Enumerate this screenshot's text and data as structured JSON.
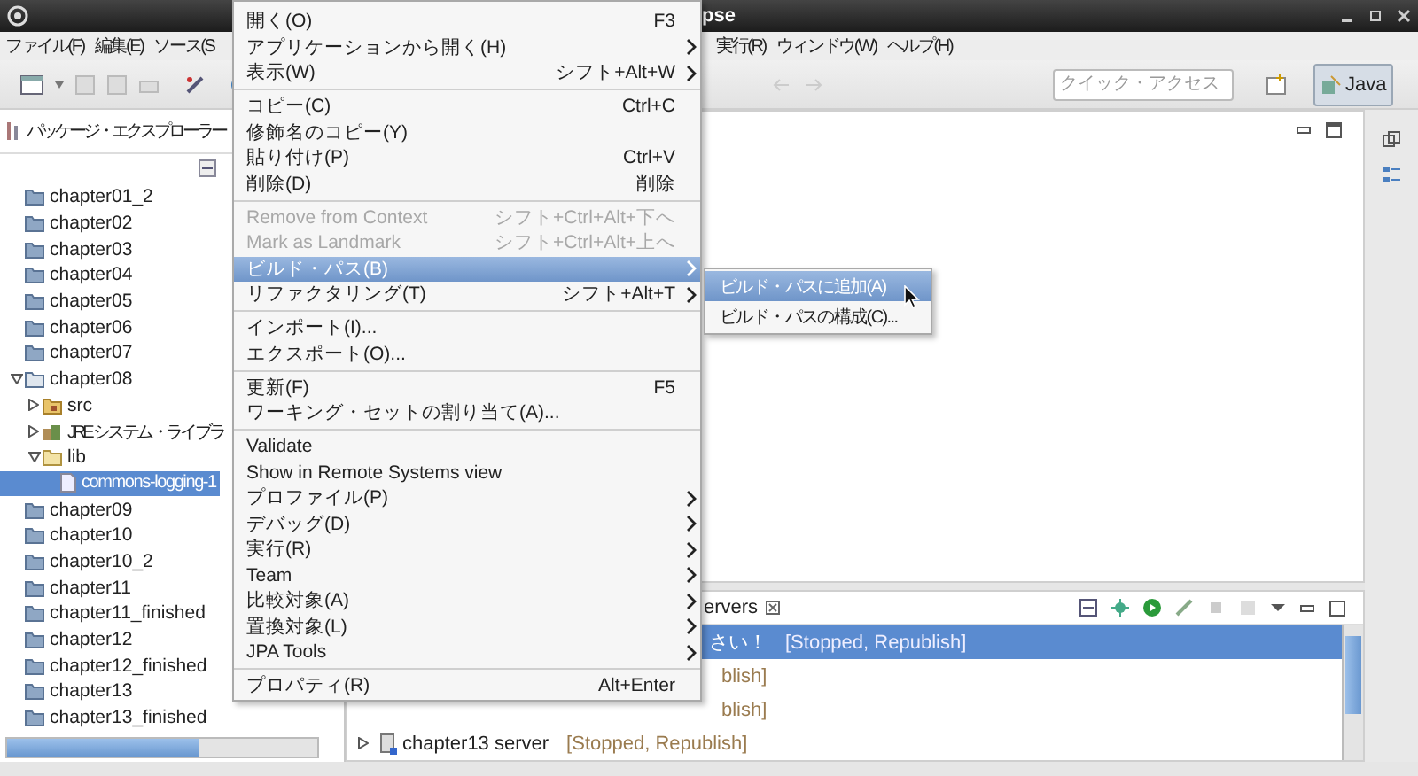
{
  "window": {
    "title": "pse"
  },
  "menubar": {
    "left": [
      {
        "label": "ファイル(F)"
      },
      {
        "label": "編集(E)"
      },
      {
        "label": "ソース(S"
      }
    ],
    "right": [
      {
        "label": "実行(R)"
      },
      {
        "label": "ウィンドウ(W)"
      },
      {
        "label": "ヘルプ(H)"
      }
    ]
  },
  "toolbar": {
    "quick_access": {
      "placeholder": "クイック・アクセス"
    },
    "perspective": {
      "label": "Java",
      "selected": true
    }
  },
  "explorer": {
    "title": "パッケージ・エクスプローラー",
    "tree": [
      {
        "kind": "project",
        "label": "chapter01_2",
        "selected": false
      },
      {
        "kind": "project",
        "label": "chapter02",
        "selected": false
      },
      {
        "kind": "project",
        "label": "chapter03",
        "selected": false
      },
      {
        "kind": "project",
        "label": "chapter04",
        "selected": false
      },
      {
        "kind": "project",
        "label": "chapter05",
        "selected": false
      },
      {
        "kind": "project",
        "label": "chapter06",
        "selected": false
      },
      {
        "kind": "project",
        "label": "chapter07",
        "selected": false
      },
      {
        "kind": "open_project",
        "label": "chapter08",
        "selected": false,
        "expanded": true,
        "children": [
          {
            "kind": "source",
            "label": "src",
            "selected": false,
            "expanded": false
          },
          {
            "kind": "library",
            "label": "JRE システム・ライブラ",
            "selected": false,
            "expanded": false
          },
          {
            "kind": "folder",
            "label": "lib",
            "selected": false,
            "expanded": true,
            "children": [
              {
                "kind": "jar",
                "label": "commons-logging-1",
                "selected": true
              }
            ]
          }
        ]
      },
      {
        "kind": "project",
        "label": "chapter09",
        "selected": false
      },
      {
        "kind": "project",
        "label": "chapter10",
        "selected": false
      },
      {
        "kind": "project",
        "label": "chapter10_2",
        "selected": false
      },
      {
        "kind": "project",
        "label": "chapter11",
        "selected": false
      },
      {
        "kind": "project",
        "label": "chapter11_finished",
        "selected": false
      },
      {
        "kind": "project",
        "label": "chapter12",
        "selected": false
      },
      {
        "kind": "project",
        "label": "chapter12_finished",
        "selected": false
      },
      {
        "kind": "project",
        "label": "chapter13",
        "selected": false
      },
      {
        "kind": "project",
        "label": "chapter13_finished",
        "selected": false
      }
    ]
  },
  "servers": {
    "tab": "ervers",
    "rows": [
      {
        "kind": "clipped",
        "label": "さい！",
        "status": "[Stopped, Republish]",
        "selected": true
      },
      {
        "kind": "clipped",
        "status": "blish]",
        "selected": false
      },
      {
        "kind": "clipped",
        "status": "blish]",
        "selected": false
      },
      {
        "kind": "server",
        "label": "chapter13 server",
        "status": "[Stopped, Republish]",
        "selected": false,
        "expanded": false
      }
    ]
  },
  "context_menu": {
    "items": [
      {
        "kind": "item",
        "label": "開く(O)",
        "shortcut": "F3",
        "submenu": false,
        "disabled": false,
        "selected": false
      },
      {
        "kind": "item",
        "label": "アプリケーションから開く(H)",
        "submenu": true,
        "disabled": false,
        "selected": false
      },
      {
        "kind": "item",
        "label": "表示(W)",
        "shortcut": "シフト+Alt+W",
        "submenu": true,
        "disabled": false,
        "selected": false
      },
      {
        "kind": "separator"
      },
      {
        "kind": "item",
        "label": "コピー(C)",
        "shortcut": "Ctrl+C",
        "submenu": false,
        "disabled": false,
        "selected": false
      },
      {
        "kind": "item",
        "label": "修飾名のコピー(Y)",
        "submenu": false,
        "disabled": false,
        "selected": false
      },
      {
        "kind": "item",
        "label": "貼り付け(P)",
        "shortcut": "Ctrl+V",
        "submenu": false,
        "disabled": false,
        "selected": false
      },
      {
        "kind": "item",
        "label": "削除(D)",
        "shortcut": "削除",
        "submenu": false,
        "disabled": false,
        "selected": false
      },
      {
        "kind": "separator"
      },
      {
        "kind": "item",
        "label": "Remove from Context",
        "shortcut": "シフト+Ctrl+Alt+下へ",
        "submenu": false,
        "disabled": true,
        "selected": false
      },
      {
        "kind": "item",
        "label": "Mark as Landmark",
        "shortcut": "シフト+Ctrl+Alt+上へ",
        "submenu": false,
        "disabled": true,
        "selected": false
      },
      {
        "kind": "item",
        "label": "ビルド・パス(B)",
        "submenu": true,
        "disabled": false,
        "selected": true
      },
      {
        "kind": "item",
        "label": "リファクタリング(T)",
        "shortcut": "シフト+Alt+T",
        "submenu": true,
        "disabled": false,
        "selected": false
      },
      {
        "kind": "separator"
      },
      {
        "kind": "item",
        "label": "インポート(I)...",
        "submenu": false,
        "disabled": false,
        "selected": false
      },
      {
        "kind": "item",
        "label": "エクスポート(O)...",
        "submenu": false,
        "disabled": false,
        "selected": false
      },
      {
        "kind": "separator"
      },
      {
        "kind": "item",
        "label": "更新(F)",
        "shortcut": "F5",
        "submenu": false,
        "disabled": false,
        "selected": false
      },
      {
        "kind": "item",
        "label": "ワーキング・セットの割り当て(A)...",
        "submenu": false,
        "disabled": false,
        "selected": false
      },
      {
        "kind": "separator"
      },
      {
        "kind": "item",
        "label": "Validate",
        "submenu": false,
        "disabled": false,
        "selected": false
      },
      {
        "kind": "item",
        "label": "Show in Remote Systems view",
        "submenu": false,
        "disabled": false,
        "selected": false
      },
      {
        "kind": "item",
        "label": "プロファイル(P)",
        "submenu": true,
        "disabled": false,
        "selected": false
      },
      {
        "kind": "item",
        "label": "デバッグ(D)",
        "submenu": true,
        "disabled": false,
        "selected": false
      },
      {
        "kind": "item",
        "label": "実行(R)",
        "submenu": true,
        "disabled": false,
        "selected": false
      },
      {
        "kind": "item",
        "label": "Team",
        "submenu": true,
        "disabled": false,
        "selected": false
      },
      {
        "kind": "item",
        "label": "比較対象(A)",
        "submenu": true,
        "disabled": false,
        "selected": false
      },
      {
        "kind": "item",
        "label": "置換対象(L)",
        "submenu": true,
        "disabled": false,
        "selected": false
      },
      {
        "kind": "item",
        "label": "JPA Tools",
        "submenu": true,
        "disabled": false,
        "selected": false
      },
      {
        "kind": "separator"
      },
      {
        "kind": "item",
        "label": "プロパティ(R)",
        "shortcut": "Alt+Enter",
        "submenu": false,
        "disabled": false,
        "selected": false
      }
    ]
  },
  "submenu": {
    "items": [
      {
        "label": "ビルド・パスに追加(A)",
        "selected": true
      },
      {
        "label": "ビルド・パスの構成(C)...",
        "selected": false
      }
    ]
  }
}
